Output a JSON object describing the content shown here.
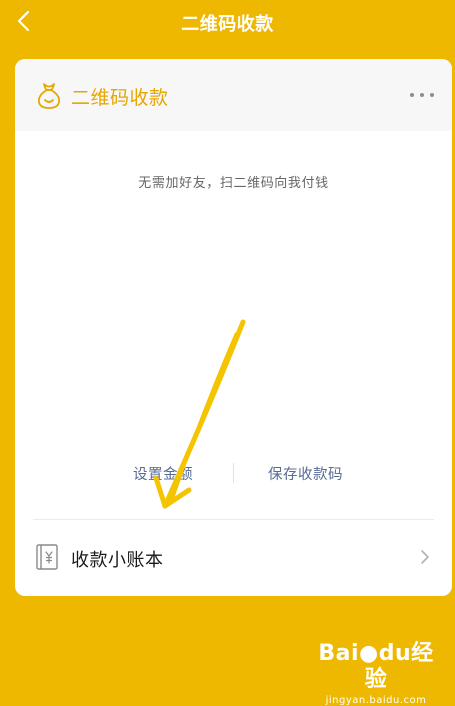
{
  "nav": {
    "title": "二维码收款",
    "back_icon": "chevron-left-icon"
  },
  "card": {
    "icon": "money-bag-icon",
    "title": "二维码收款",
    "more_icon": "more-horizontal-icon",
    "tip": "无需加好友，扫二维码向我付钱",
    "actions": {
      "set_amount": "设置金额",
      "save_code": "保存收款码"
    },
    "ledger": {
      "icon": "ledger-yen-icon",
      "label": "收款小账本",
      "chevron_icon": "chevron-right-icon"
    }
  },
  "watermark": {
    "brand_prefix": "Bai",
    "brand_mid": "du",
    "brand_suffix": "经验",
    "url": "jingyan.baidu.com"
  },
  "colors": {
    "background": "#EFB800",
    "accent": "#E7A600",
    "link": "#576B95",
    "annotation_arrow": "#F5C400"
  }
}
